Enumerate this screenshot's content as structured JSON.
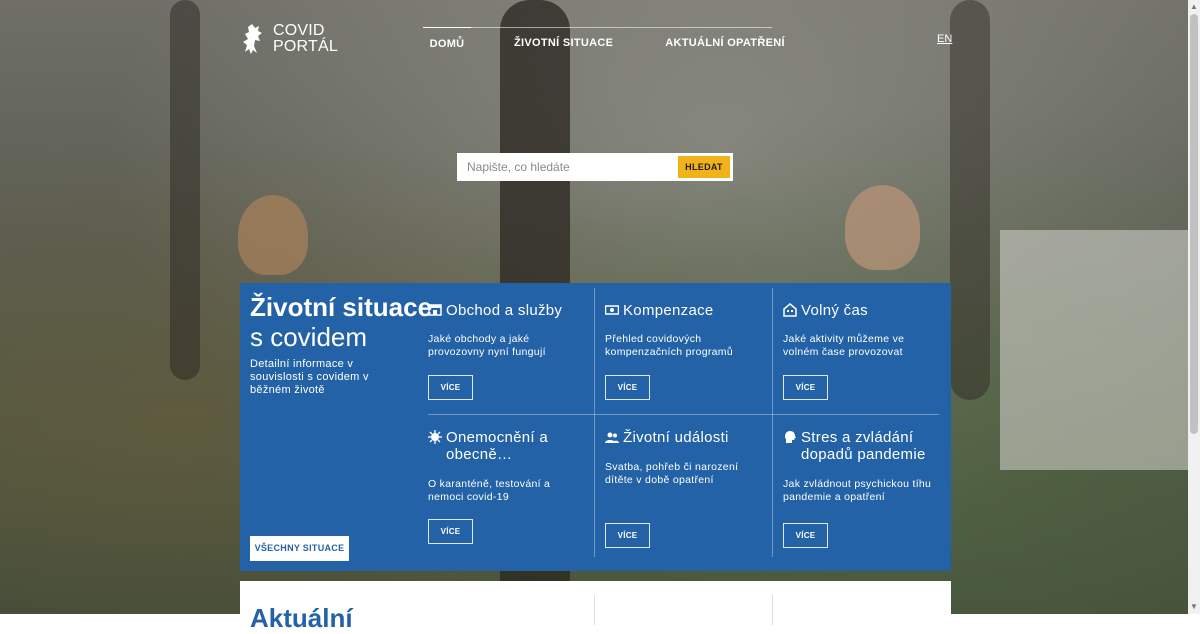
{
  "header": {
    "logo_line1": "COVID",
    "logo_line2": "PORTÁL",
    "nav": [
      "DOMŮ",
      "ŽIVOTNÍ SITUACE",
      "AKTUÁLNÍ OPATŘENÍ"
    ],
    "lang": "EN"
  },
  "search": {
    "placeholder": "Napište, co hledáte",
    "button": "HLEDAT"
  },
  "intro": {
    "title": "Životní situace",
    "subtitle": "s covidem",
    "description": "Detailní informace v souvislosti s covidem v běžném životě",
    "all_button": "VŠECHNY SITUACE"
  },
  "cards": [
    {
      "icon": "shop-icon",
      "title": "Obchod a služby",
      "description": "Jaké obchody a jaké provozovny nyní fungují",
      "button": "VÍCE"
    },
    {
      "icon": "money-icon",
      "title": "Kompenzace",
      "description": "Přehled covidových kompenzačních programů",
      "button": "VÍCE"
    },
    {
      "icon": "building-icon",
      "title": "Volný čas",
      "description": "Jaké aktivity můžeme ve volném čase provozovat",
      "button": "VÍCE"
    },
    {
      "icon": "virus-icon",
      "title": "Onemocnění a obecně…",
      "description": "O karanténě, testování a nemoci covid-19",
      "button": "VÍCE"
    },
    {
      "icon": "people-icon",
      "title": "Životní události",
      "description": "Svatba, pohřeb či narození dítěte v době opatření",
      "button": "VÍCE"
    },
    {
      "icon": "head-icon",
      "title": "Stres a zvládání dopadů pandemie",
      "description": "Jak zvládnout psychickou tíhu pandemie a opatření",
      "button": "VÍCE"
    }
  ],
  "bottom": {
    "heading": "Aktuální"
  }
}
